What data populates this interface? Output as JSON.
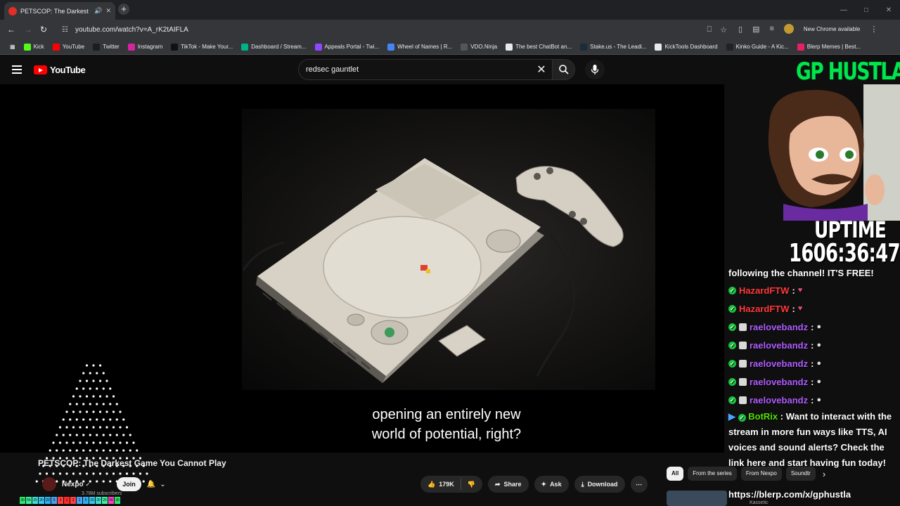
{
  "browser": {
    "tab_title": "PETSCOP: The Darkest Gam",
    "url": "youtube.com/watch?v=A_rK2tAIFLA",
    "new_chrome_label": "New Chrome available",
    "bookmarks": [
      {
        "label": "Kick",
        "color": "#53fc18"
      },
      {
        "label": "YouTube",
        "color": "#ff0000"
      },
      {
        "label": "Twitter",
        "color": "#1d1d1d"
      },
      {
        "label": "Instagram",
        "color": "#d6249f"
      },
      {
        "label": "TikTok - Make Your...",
        "color": "#111111"
      },
      {
        "label": "Dashboard / Stream...",
        "color": "#00b386"
      },
      {
        "label": "Appeals Portal - Twi...",
        "color": "#9146ff"
      },
      {
        "label": "Wheel of Names | R...",
        "color": "#4285f4"
      },
      {
        "label": "VDO.Ninja",
        "color": "#555555"
      },
      {
        "label": "The best ChatBot an...",
        "color": "#e8eaed"
      },
      {
        "label": "Stake.us - The Leadi...",
        "color": "#1a2c38"
      },
      {
        "label": "KickTools Dashboard",
        "color": "#e8eaed"
      },
      {
        "label": "Kinko Guide - A Kic...",
        "color": "#222222"
      },
      {
        "label": "Blerp Memes | Best...",
        "color": "#e91e63"
      }
    ]
  },
  "youtube": {
    "logo_text": "YouTube",
    "search_query": "redsec gauntlet"
  },
  "video": {
    "caption_line1": "opening an entirely new",
    "caption_line2": "world of potential, right?",
    "title": "PETSCOP: The Darkest Game You Cannot Play",
    "channel": "Nexpo",
    "subscribers": "3.78M subscribers",
    "join_label": "Join",
    "likes": "179K",
    "share_label": "Share",
    "ask_label": "Ask",
    "download_label": "Download"
  },
  "chips": [
    "All",
    "From the series",
    "From Nexpo",
    "Soundtr"
  ],
  "sidebar_video_channel": "Kassetic",
  "overlay": {
    "streamer_name": "GP HUSTLA",
    "uptime_label": "UPTIME",
    "uptime_value": "1606:36:47",
    "follow_line": "following the channel! IT'S FREE!",
    "chat": [
      {
        "user": "HazardFTW",
        "color": "#ff3b3b",
        "mod": false
      },
      {
        "user": "HazardFTW",
        "color": "#ff3b3b",
        "mod": false
      },
      {
        "user": "raelovebandz",
        "color": "#b05cff",
        "mod": true
      },
      {
        "user": "raelovebandz",
        "color": "#b05cff",
        "mod": true
      },
      {
        "user": "raelovebandz",
        "color": "#b05cff",
        "mod": true
      },
      {
        "user": "raelovebandz",
        "color": "#b05cff",
        "mod": true
      },
      {
        "user": "raelovebandz",
        "color": "#b05cff",
        "mod": true
      }
    ],
    "bot_name": "BotRix",
    "bot_message": "Want to interact with the stream in more fun ways like TTS, AI voices and sound alerts? Check the link here and start having fun today!",
    "bot_link": "https://blerp.com/x/gphustla"
  },
  "plinko_bins": [
    "30",
    "56",
    "25",
    "20",
    "20",
    "5",
    "3",
    "1",
    "3",
    "1",
    "5",
    "20",
    "20",
    "25",
    "56",
    "30"
  ]
}
